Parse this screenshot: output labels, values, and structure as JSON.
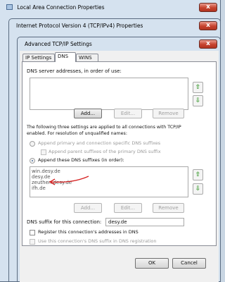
{
  "windows": {
    "back_title": "Local Area Connection Properties",
    "mid_title": "Internet Protocol Version 4 (TCP/IPv4) Properties",
    "front_title": "Advanced TCP/IP Settings",
    "close_glyph": "x"
  },
  "tabs": [
    {
      "label": "IP Settings",
      "active": false
    },
    {
      "label": "DNS",
      "active": true
    },
    {
      "label": "WINS",
      "active": false
    }
  ],
  "dns": {
    "servers_label": "DNS server addresses, in order of use:",
    "add": "Add...",
    "edit": "Edit...",
    "remove": "Remove",
    "info_line1": "The following three settings are applied to all connections with TCP/IP",
    "info_line2": "enabled. For resolution of unqualified names:",
    "radio_primary": "Append primary and connection specific DNS suffixes",
    "check_parent": "Append parent suffixes of the primary DNS suffix",
    "radio_these": "Append these DNS suffixes (in order):",
    "suffixes": [
      "win.desy.de",
      "desy.de",
      "zeuthen.desy.de",
      "ifh.de"
    ],
    "add2": "Add...",
    "edit2": "Edit...",
    "remove2": "Remove",
    "connection_suffix_label": "DNS suffix for this connection:",
    "connection_suffix_value": "desy.de",
    "register_label": "Register this connection's addresses in DNS",
    "use_suffix_label": "Use this connection's DNS suffix in DNS registration"
  },
  "footer": {
    "ok": "OK",
    "cancel": "Cancel"
  },
  "colors": {
    "annotation_arrow": "#d62020",
    "arrow_icon": "#3a9a2f"
  }
}
